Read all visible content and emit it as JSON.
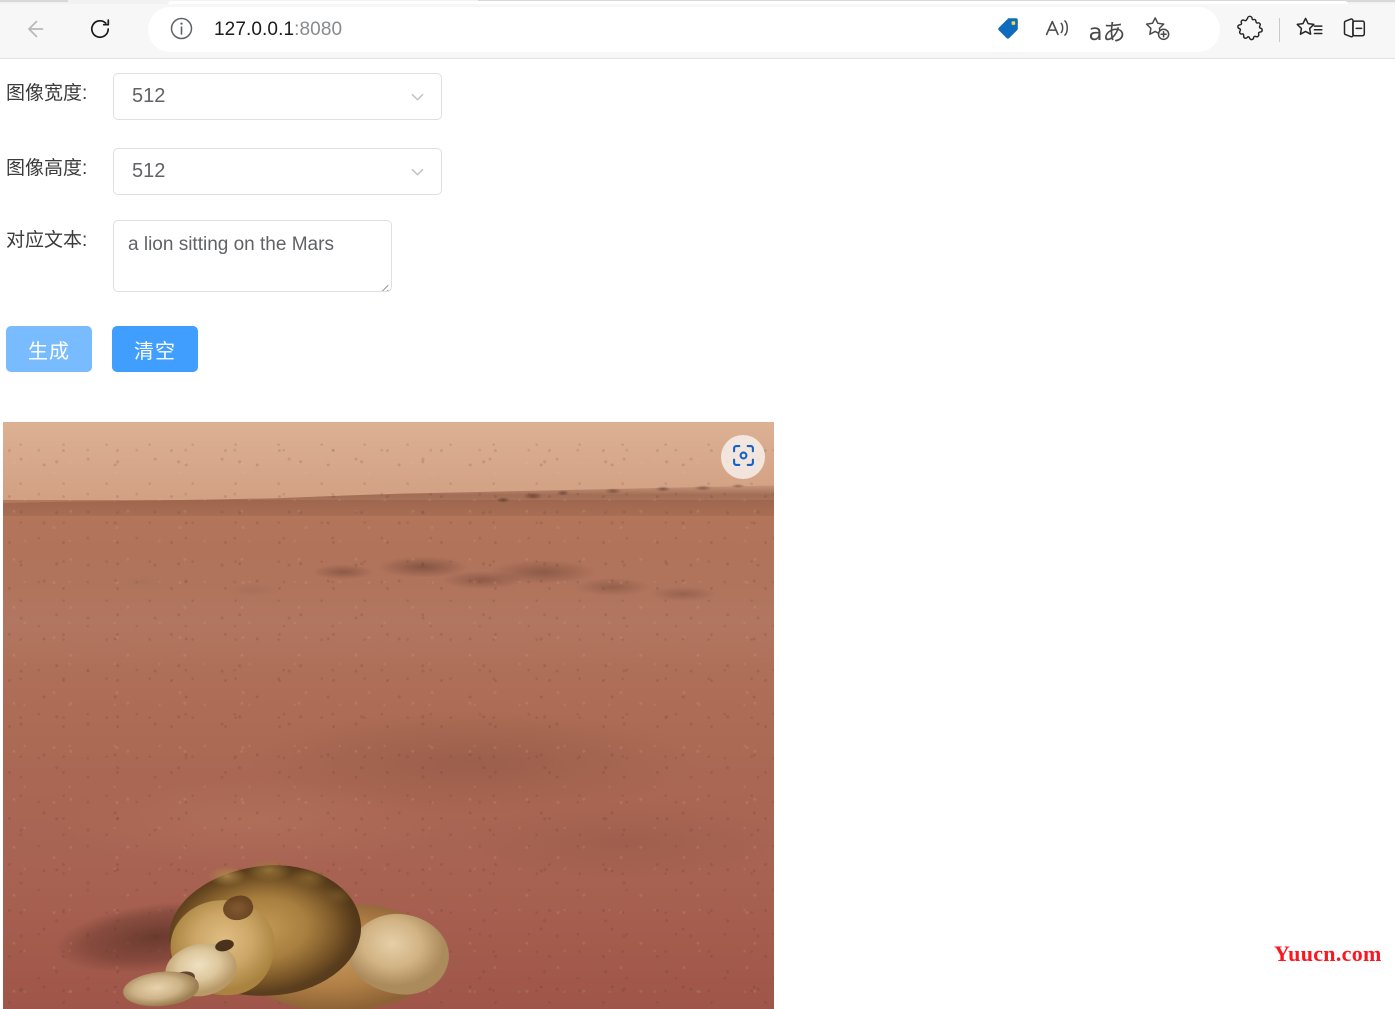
{
  "browser": {
    "name": "Microsoft Edge",
    "back_label": "Back",
    "back_icon": "arrow-left-icon",
    "back_enabled": false,
    "reload_label": "Refresh",
    "reload_icon": "reload-icon",
    "address_bar": {
      "site_info_icon": "info-circle-icon",
      "url_host": "127.0.0.1",
      "url_port": ":8080",
      "full_url": "127.0.0.1:8080"
    },
    "omnibox_actions": [
      {
        "name": "shopping-tag-icon",
        "label": "Shopping",
        "color": "#0f6cbd"
      },
      {
        "name": "read-aloud-icon",
        "label": "Read aloud"
      },
      {
        "name": "translate-icon",
        "label": "Translate",
        "glyph": "aあ"
      },
      {
        "name": "add-favorite-icon",
        "label": "Add this page to favorites"
      }
    ],
    "toolbar_right": [
      {
        "name": "extensions-icon",
        "label": "Extensions"
      },
      {
        "name": "toolbar-divider",
        "label": "Divider"
      },
      {
        "name": "favorites-icon",
        "label": "Favorites"
      },
      {
        "name": "collections-icon",
        "label": "Collections"
      }
    ]
  },
  "page": {
    "form": {
      "width_field": {
        "label": "图像宽度:",
        "value": "512",
        "caret_icon": "chevron-down-icon"
      },
      "height_field": {
        "label": "图像高度:",
        "value": "512",
        "caret_icon": "chevron-down-icon"
      },
      "text_field": {
        "label": "对应文本:",
        "value": "a lion sitting on the Mars",
        "placeholder": ""
      }
    },
    "buttons": [
      {
        "name": "generate-button",
        "label": "生成",
        "color": "#79bbff"
      },
      {
        "name": "clear-button",
        "label": "清空",
        "color": "#409eff"
      }
    ],
    "result_image": {
      "alt": "a lion sitting on the Mars",
      "description": "AI generated photo of a lion with a golden mane lying on reddish Martian soil under a tan sky",
      "width": "512",
      "height": "512",
      "overlay_button": {
        "name": "visual-search-button",
        "label": "Search image with Bing",
        "icon": "visual-search-camera-icon",
        "icon_color": "#1261c9"
      },
      "colors": {
        "sky": "#d8a98c",
        "ground_near": "#a3594a",
        "ground_far": "#b2745a",
        "lion_mane": "#a87f3f",
        "lion_body": "#d2b485"
      }
    },
    "watermark": {
      "text": "Yuucn.com",
      "color": "#fa1720"
    }
  }
}
